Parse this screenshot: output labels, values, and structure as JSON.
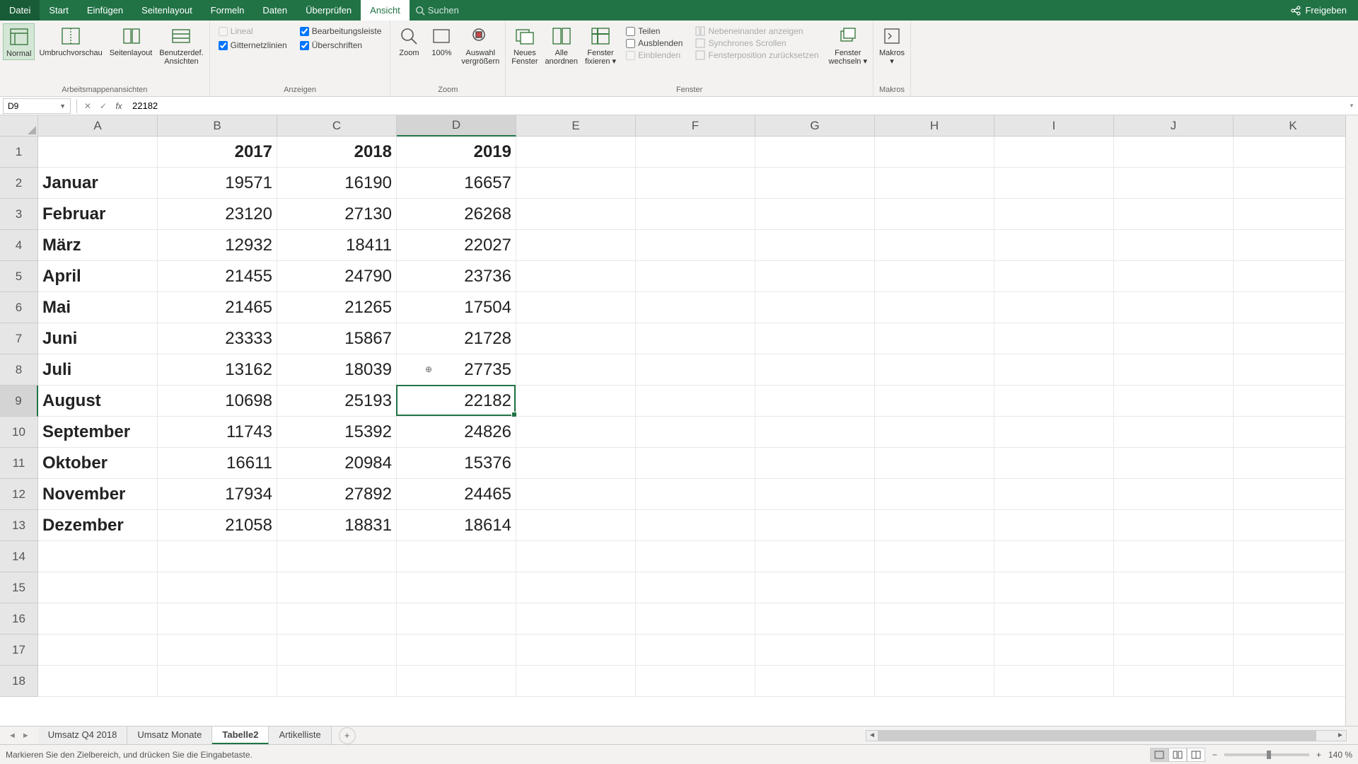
{
  "menu": {
    "file": "Datei",
    "tabs": [
      "Start",
      "Einfügen",
      "Seitenlayout",
      "Formeln",
      "Daten",
      "Überprüfen",
      "Ansicht"
    ],
    "active": "Ansicht",
    "search_placeholder": "Suchen",
    "share": "Freigeben"
  },
  "ribbon": {
    "views": {
      "normal": "Normal",
      "page_break": "Umbruchvorschau",
      "page_layout": "Seitenlayout",
      "custom": "Benutzerdef.\nAnsichten",
      "group": "Arbeitsmappenansichten"
    },
    "show": {
      "ruler": "Lineal",
      "formula_bar": "Bearbeitungsleiste",
      "gridlines": "Gitternetzlinien",
      "headings": "Überschriften",
      "group": "Anzeigen"
    },
    "zoom": {
      "zoom": "Zoom",
      "pct100": "100%",
      "to_selection": "Auswahl\nvergrößern",
      "group": "Zoom"
    },
    "window": {
      "new": "Neues\nFenster",
      "arrange": "Alle\nanordnen",
      "freeze": "Fenster\nfixieren ▾",
      "split": "Teilen",
      "hide": "Ausblenden",
      "unhide": "Einblenden",
      "side_by_side": "Nebeneinander anzeigen",
      "sync_scroll": "Synchrones Scrollen",
      "reset_pos": "Fensterposition zurücksetzen",
      "switch": "Fenster\nwechseln ▾",
      "group": "Fenster"
    },
    "macros": {
      "macros": "Makros\n▾",
      "group": "Makros"
    }
  },
  "formula_bar": {
    "cell_ref": "D9",
    "value": "22182"
  },
  "columns": [
    "A",
    "B",
    "C",
    "D",
    "E",
    "F",
    "G",
    "H",
    "I",
    "J",
    "K"
  ],
  "selected_col": "D",
  "rows": [
    1,
    2,
    3,
    4,
    5,
    6,
    7,
    8,
    9,
    10,
    11,
    12,
    13,
    14,
    15,
    16,
    17,
    18
  ],
  "selected_row": 9,
  "chart_data": {
    "type": "table",
    "headers": {
      "B": "2017",
      "C": "2018",
      "D": "2019"
    },
    "rows": [
      {
        "A": "Januar",
        "B": 19571,
        "C": 16190,
        "D": 16657
      },
      {
        "A": "Februar",
        "B": 23120,
        "C": 27130,
        "D": 26268
      },
      {
        "A": "März",
        "B": 12932,
        "C": 18411,
        "D": 22027
      },
      {
        "A": "April",
        "B": 21455,
        "C": 24790,
        "D": 23736
      },
      {
        "A": "Mai",
        "B": 21465,
        "C": 21265,
        "D": 17504
      },
      {
        "A": "Juni",
        "B": 23333,
        "C": 15867,
        "D": 21728
      },
      {
        "A": "Juli",
        "B": 13162,
        "C": 18039,
        "D": 27735
      },
      {
        "A": "August",
        "B": 10698,
        "C": 25193,
        "D": 22182
      },
      {
        "A": "September",
        "B": 11743,
        "C": 15392,
        "D": 24826
      },
      {
        "A": "Oktober",
        "B": 16611,
        "C": 20984,
        "D": 15376
      },
      {
        "A": "November",
        "B": 17934,
        "C": 27892,
        "D": 24465
      },
      {
        "A": "Dezember",
        "B": 21058,
        "C": 18831,
        "D": 18614
      }
    ]
  },
  "sheets": {
    "tabs": [
      "Umsatz Q4 2018",
      "Umsatz Monate",
      "Tabelle2",
      "Artikelliste"
    ],
    "active": "Tabelle2"
  },
  "status": {
    "message": "Markieren Sie den Zielbereich, und drücken Sie die Eingabetaste.",
    "zoom": "140 %"
  }
}
